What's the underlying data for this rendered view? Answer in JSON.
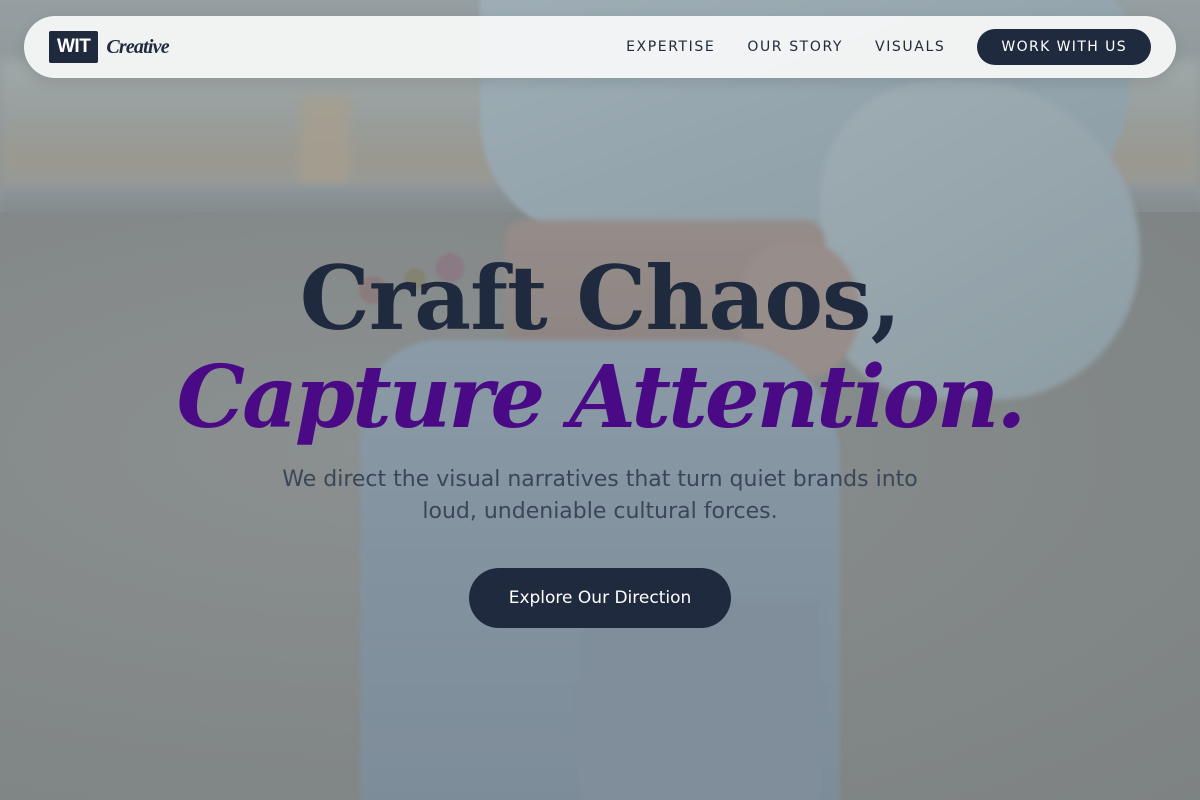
{
  "brand": {
    "mark": "WIT",
    "word": "Creative"
  },
  "nav": {
    "links": [
      "EXPERTISE",
      "OUR STORY",
      "VISUALS"
    ],
    "cta": "WORK WITH US"
  },
  "hero": {
    "headline_line1": "Craft Chaos,",
    "headline_line2": "Capture Attention.",
    "subheading": "We direct the visual narratives that turn quiet brands into loud, undeniable cultural forces.",
    "cta": "Explore Our Direction"
  },
  "colors": {
    "navy": "#1f2a3e",
    "accent_purple": "#4a0a86"
  }
}
